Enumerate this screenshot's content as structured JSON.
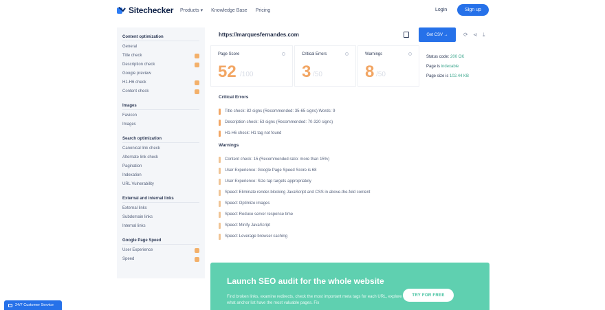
{
  "header": {
    "brand": "Sitechecker",
    "nav": [
      "Products",
      "Knowledge Base",
      "Pricing"
    ],
    "products_caret": "▾",
    "login": "Login",
    "signup": "Sign up"
  },
  "sidebar": {
    "groups": [
      {
        "title": "Content optimization",
        "items": [
          {
            "label": "General",
            "flag": false
          },
          {
            "label": "Title check",
            "flag": true
          },
          {
            "label": "Description check",
            "flag": true
          },
          {
            "label": "Google preview",
            "flag": false
          },
          {
            "label": "H1-H6 check",
            "flag": true
          },
          {
            "label": "Content check",
            "flag": true
          }
        ]
      },
      {
        "title": "Images",
        "items": [
          {
            "label": "Favicon",
            "flag": false
          },
          {
            "label": "Images",
            "flag": false
          }
        ]
      },
      {
        "title": "Search optimization",
        "items": [
          {
            "label": "Canonical link check",
            "flag": false
          },
          {
            "label": "Alternate link check",
            "flag": false
          },
          {
            "label": "Pagination",
            "flag": false
          },
          {
            "label": "Indexation",
            "flag": false
          },
          {
            "label": "URL Vulnerability",
            "flag": false
          }
        ]
      },
      {
        "title": "External and internal links",
        "items": [
          {
            "label": "External links",
            "flag": false
          },
          {
            "label": "Subdomain links",
            "flag": false
          },
          {
            "label": "Internal links",
            "flag": false
          }
        ]
      },
      {
        "title": "Google Page Speed",
        "items": [
          {
            "label": "User Experience",
            "flag": true
          },
          {
            "label": "Speed",
            "flag": true
          }
        ]
      }
    ]
  },
  "toolbar": {
    "url": "https://marquesfernandes.com",
    "audit_button": "Get CSV →"
  },
  "cards": {
    "page_score": {
      "label": "Page Score",
      "value": "52",
      "suffix": "/100"
    },
    "critical_errors": {
      "label": "Critical Errors",
      "value": "3",
      "suffix": "/50"
    },
    "warnings": {
      "label": "Warnings",
      "value": "8",
      "suffix": "/50"
    }
  },
  "status": {
    "status_code_label": "Status code:",
    "status_code": "200 OK",
    "page_label": "Page is",
    "page_value": "indexable",
    "size_label": "Page size is",
    "size_value": "102.44 KB"
  },
  "critical": {
    "title": "Critical Errors",
    "items": [
      "Title check: 82 signs (Recommended: 35-65 signs) Words: 9",
      "Description check: 53 signs (Recommended: 70-320 signs)",
      "H1-H6 check: H1 tag not found"
    ]
  },
  "warnings": {
    "title": "Warnings",
    "items": [
      "Content check: 15 (Recommended ratio: more than 15%)",
      "User Experience: Google Page Speed Score is 68",
      "User Experience: Size tap targets appropriately",
      "Speed: Eliminate render-blocking JavaScript and CSS in above-the-fold content",
      "Speed: Optimize images",
      "Speed: Reduce server response time",
      "Speed: Minify JavaScript",
      "Speed: Leverage browser caching"
    ]
  },
  "banner": {
    "title": "Launch SEO audit for the whole website",
    "text": "Find broken links, examine redirects, check the most important meta tags for each URL, explore what anchor list have the most valuable pages. Fix",
    "button": "TRY FOR FREE"
  },
  "support": "24/7 Customer Service",
  "colors": {
    "accent": "#2671e9",
    "score": "#f2a664",
    "banner": "#5fd0b0",
    "ok": "#3aa58c"
  }
}
